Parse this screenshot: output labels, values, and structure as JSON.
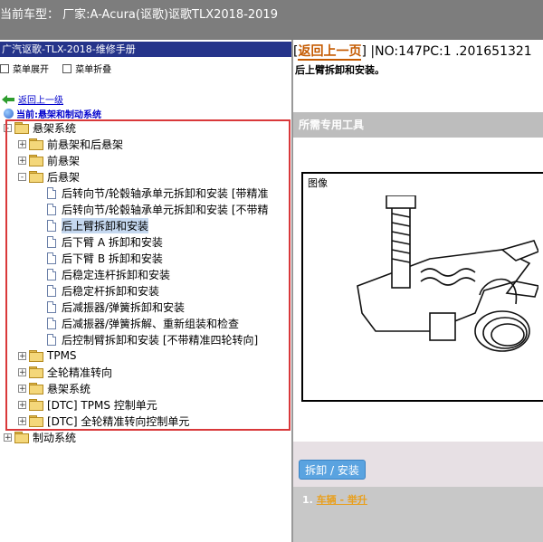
{
  "window": {
    "title": "当前车型：  厂家:A-Acura(讴歌)讴歌TLX2018-2019"
  },
  "left": {
    "header": "广汽讴歌-TLX-2018-维修手册",
    "toolbar": {
      "expand_all": "菜单展开",
      "collapse_all": "菜单折叠"
    },
    "back_link": "返回上一级",
    "current_location": "当前:悬架和制动系统",
    "tree": [
      {
        "label": "悬架系统",
        "type": "folder",
        "expander": "-",
        "level": 0
      },
      {
        "label": "前悬架和后悬架",
        "type": "folder",
        "expander": "+",
        "level": 1
      },
      {
        "label": "前悬架",
        "type": "folder",
        "expander": "+",
        "level": 1
      },
      {
        "label": "后悬架",
        "type": "folder",
        "expander": "-",
        "level": 1
      },
      {
        "label": "后转向节/轮毂轴承单元拆卸和安装 [带精准",
        "type": "doc",
        "level": 2
      },
      {
        "label": "后转向节/轮毂轴承单元拆卸和安装 [不带精",
        "type": "doc",
        "level": 2
      },
      {
        "label": "后上臂拆卸和安装",
        "type": "doc",
        "level": 2,
        "selected": true
      },
      {
        "label": "后下臂 A 拆卸和安装",
        "type": "doc",
        "level": 2
      },
      {
        "label": "后下臂 B 拆卸和安装",
        "type": "doc",
        "level": 2
      },
      {
        "label": "后稳定连杆拆卸和安装",
        "type": "doc",
        "level": 2
      },
      {
        "label": "后稳定杆拆卸和安装",
        "type": "doc",
        "level": 2
      },
      {
        "label": "后减振器/弹簧拆卸和安装",
        "type": "doc",
        "level": 2
      },
      {
        "label": "后减振器/弹簧拆解、重新组装和检查",
        "type": "doc",
        "level": 2
      },
      {
        "label": "后控制臂拆卸和安装 [不带精准四轮转向]",
        "type": "doc",
        "level": 2
      },
      {
        "label": "TPMS",
        "type": "folder",
        "expander": "+",
        "level": 1
      },
      {
        "label": "全轮精准转向",
        "type": "folder",
        "expander": "+",
        "level": 1
      },
      {
        "label": "悬架系统",
        "type": "folder",
        "expander": "+",
        "level": 1
      },
      {
        "label": "[DTC] TPMS 控制单元",
        "type": "folder",
        "expander": "+",
        "level": 1
      },
      {
        "label": "[DTC] 全轮精准转向控制单元",
        "type": "folder",
        "expander": "+",
        "level": 1
      },
      {
        "label": "制动系统",
        "type": "folder",
        "expander": "+",
        "level": 0
      }
    ]
  },
  "right": {
    "back_button": "返回上一页",
    "doc_number": "|NO:147PC:1 .201651321",
    "subtitle": "后上臂拆卸和安装。",
    "tools_section": "所需专用工具",
    "figure_label": "图像",
    "action_button": "拆卸 / 安装",
    "step_number": "1.",
    "step_link": "车辆 - 举升"
  },
  "colors": {
    "topbar": "#7d7d7d",
    "left_header": "#25348a",
    "highlight_frame": "#d9383a",
    "action_button": "#5aa3e0",
    "back_button_text": "#c55a00"
  }
}
